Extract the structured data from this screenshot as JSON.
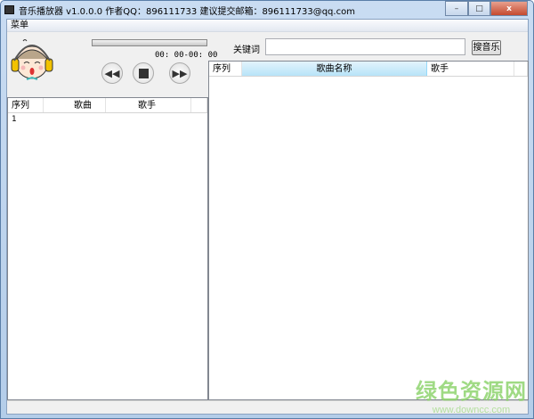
{
  "window": {
    "title": "音乐播放器 v1.0.0.0  作者QQ：896111733 建议提交邮箱：896111733@qq.com",
    "minimize": "–",
    "maximize": "□",
    "close": "x"
  },
  "menu": {
    "items": [
      "菜单"
    ]
  },
  "player": {
    "time": "00: 00-00: 00",
    "progress": 0
  },
  "search": {
    "label": "关键词",
    "value": "",
    "button": "搜音乐"
  },
  "playlist": {
    "columns": [
      "序列",
      "歌曲",
      "歌手"
    ],
    "rows": [
      {
        "index": "1",
        "song": "",
        "artist": ""
      }
    ]
  },
  "results": {
    "columns": [
      "序列",
      "歌曲名称",
      "歌手"
    ],
    "rows": []
  },
  "watermark": {
    "title": "绿色资源网",
    "url": "www.downcc.com"
  }
}
